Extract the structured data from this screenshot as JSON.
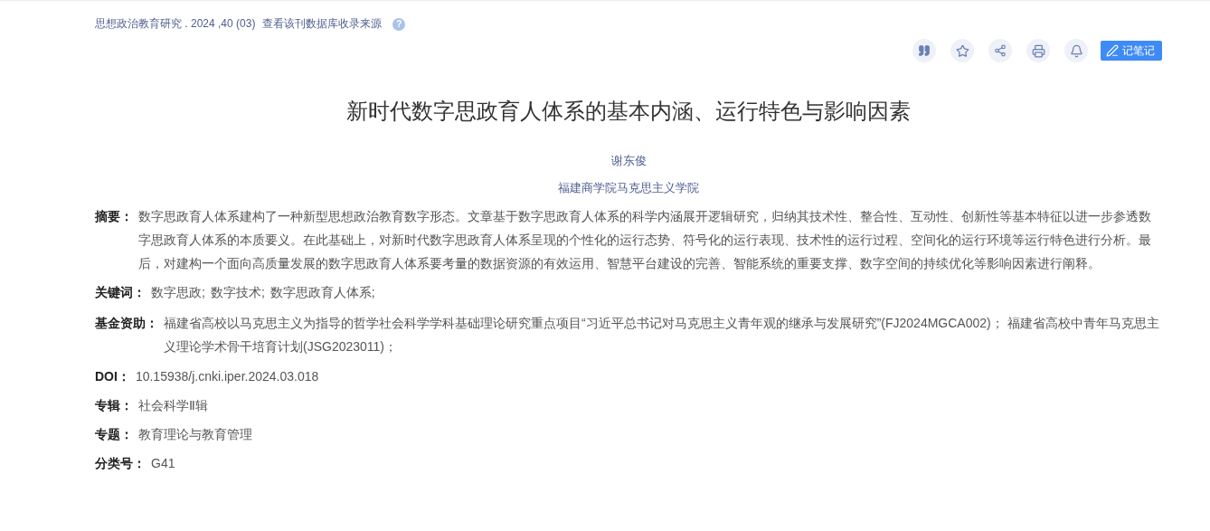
{
  "source": {
    "journal": "思想政治教育研究 .  2024 ,40 (03)",
    "link": "查看该刊数据库收录来源",
    "help": "?"
  },
  "toolbar": {
    "note_button": "记笔记"
  },
  "title": "新时代数字思政育人体系的基本内涵、运行特色与影响因素",
  "author": "谢东俊",
  "affiliation": "福建商学院马克思主义学院",
  "fields": [
    {
      "kind": "text",
      "label": "摘要：",
      "value": "数字思政育人体系建构了一种新型思想政治教育数字形态。文章基于数字思政育人体系的科学内涵展开逻辑研究，归纳其技术性、整合性、互动性、创新性等基本特征以进一步参透数字思政育人体系的本质要义。在此基础上，对新时代数字思政育人体系呈现的个性化的运行态势、符号化的运行表现、技术性的运行过程、空间化的运行环境等运行特色进行分析。最后，对建构一个面向高质量发展的数字思政育人体系要考量的数据资源的有效运用、智慧平台建设的完善、智能系统的重要支撑、数字空间的持续优化等影响因素进行阐释。"
    },
    {
      "kind": "keywords",
      "label": "关键词：",
      "items": [
        "数字思政;",
        "数字技术;",
        "数字思政育人体系;"
      ]
    },
    {
      "kind": "text",
      "label": "基金资助：",
      "value": "福建省高校以马克思主义为指导的哲学社会科学学科基础理论研究重点项目“习近平总书记对马克思主义青年观的继承与发展研究”(FJ2024MGCA002)；  福建省高校中青年马克思主义理论学术骨干培育计划(JSG2023011)；"
    },
    {
      "kind": "text",
      "label": "DOI：",
      "value": "10.15938/j.cnki.iper.2024.03.018"
    },
    {
      "kind": "text",
      "label": "专辑：",
      "value": "社会科学Ⅱ辑"
    },
    {
      "kind": "text",
      "label": "专题：",
      "value": "教育理论与教育管理"
    },
    {
      "kind": "text",
      "label": "分类号：",
      "value": "G41"
    }
  ]
}
